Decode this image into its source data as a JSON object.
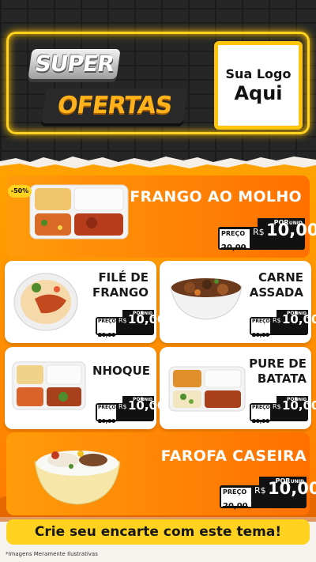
{
  "header": {
    "brand_line1": "SUPER",
    "brand_line2": "OFERTAS",
    "logo_line1": "Sua Logo",
    "logo_line2": "Aqui"
  },
  "discount_badge": "-50%",
  "price_labels": {
    "por": "POR",
    "preco": "PREÇO",
    "de_prefix": "DE",
    "old_price": "20,00",
    "currency": "R$",
    "new_price": "10,00",
    "unit": "UNID"
  },
  "products": [
    {
      "name": "FRANGO AO MOLHO"
    },
    {
      "name_line1": "FILÉ DE",
      "name_line2": "FRANGO"
    },
    {
      "name_line1": "CARNE",
      "name_line2": "ASSADA"
    },
    {
      "name": "NHOQUE"
    },
    {
      "name_line1": "PURE DE",
      "name_line2": "BATATA"
    },
    {
      "name": "FAROFA CASEIRA"
    }
  ],
  "cta": "Crie seu encarte com este tema!",
  "disclaimer": "*Imagens Meramente Ilustrativas",
  "colors": {
    "accent_yellow": "#ffd21f",
    "orange": "#ff8a00",
    "dark": "#262626"
  }
}
